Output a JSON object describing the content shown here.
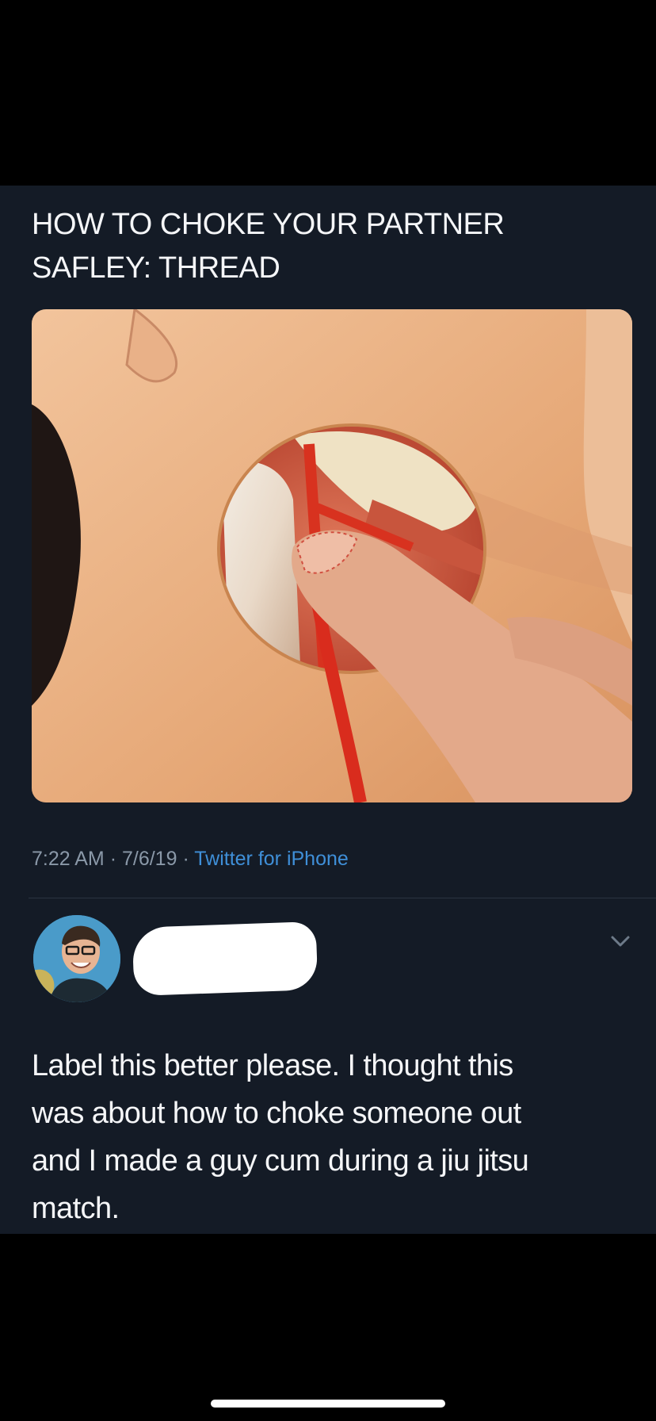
{
  "tweet": {
    "text_lines": [
      "HOW TO CHOKE YOUR PARTNER",
      "SAFLEY: THREAD"
    ],
    "media_icon": "neck-anatomy-illustration",
    "time": "7:22 AM",
    "separator": "·",
    "date": "7/6/19",
    "source": "Twitter for iPhone"
  },
  "reply": {
    "avatar_icon": "user-avatar",
    "name_redacted": true,
    "menu_icon": "chevron-down-icon",
    "text_lines": [
      "Label this better please. I thought this",
      "was about how to choke someone out",
      "and I made a guy cum during a jiu jitsu",
      "match."
    ]
  },
  "colors": {
    "page_background": "#000000",
    "panel_background": "#141b26",
    "text": "#f5f6f8",
    "meta_text": "#8a98a8",
    "link": "#3f8fd8",
    "divider": "#2a3442"
  }
}
